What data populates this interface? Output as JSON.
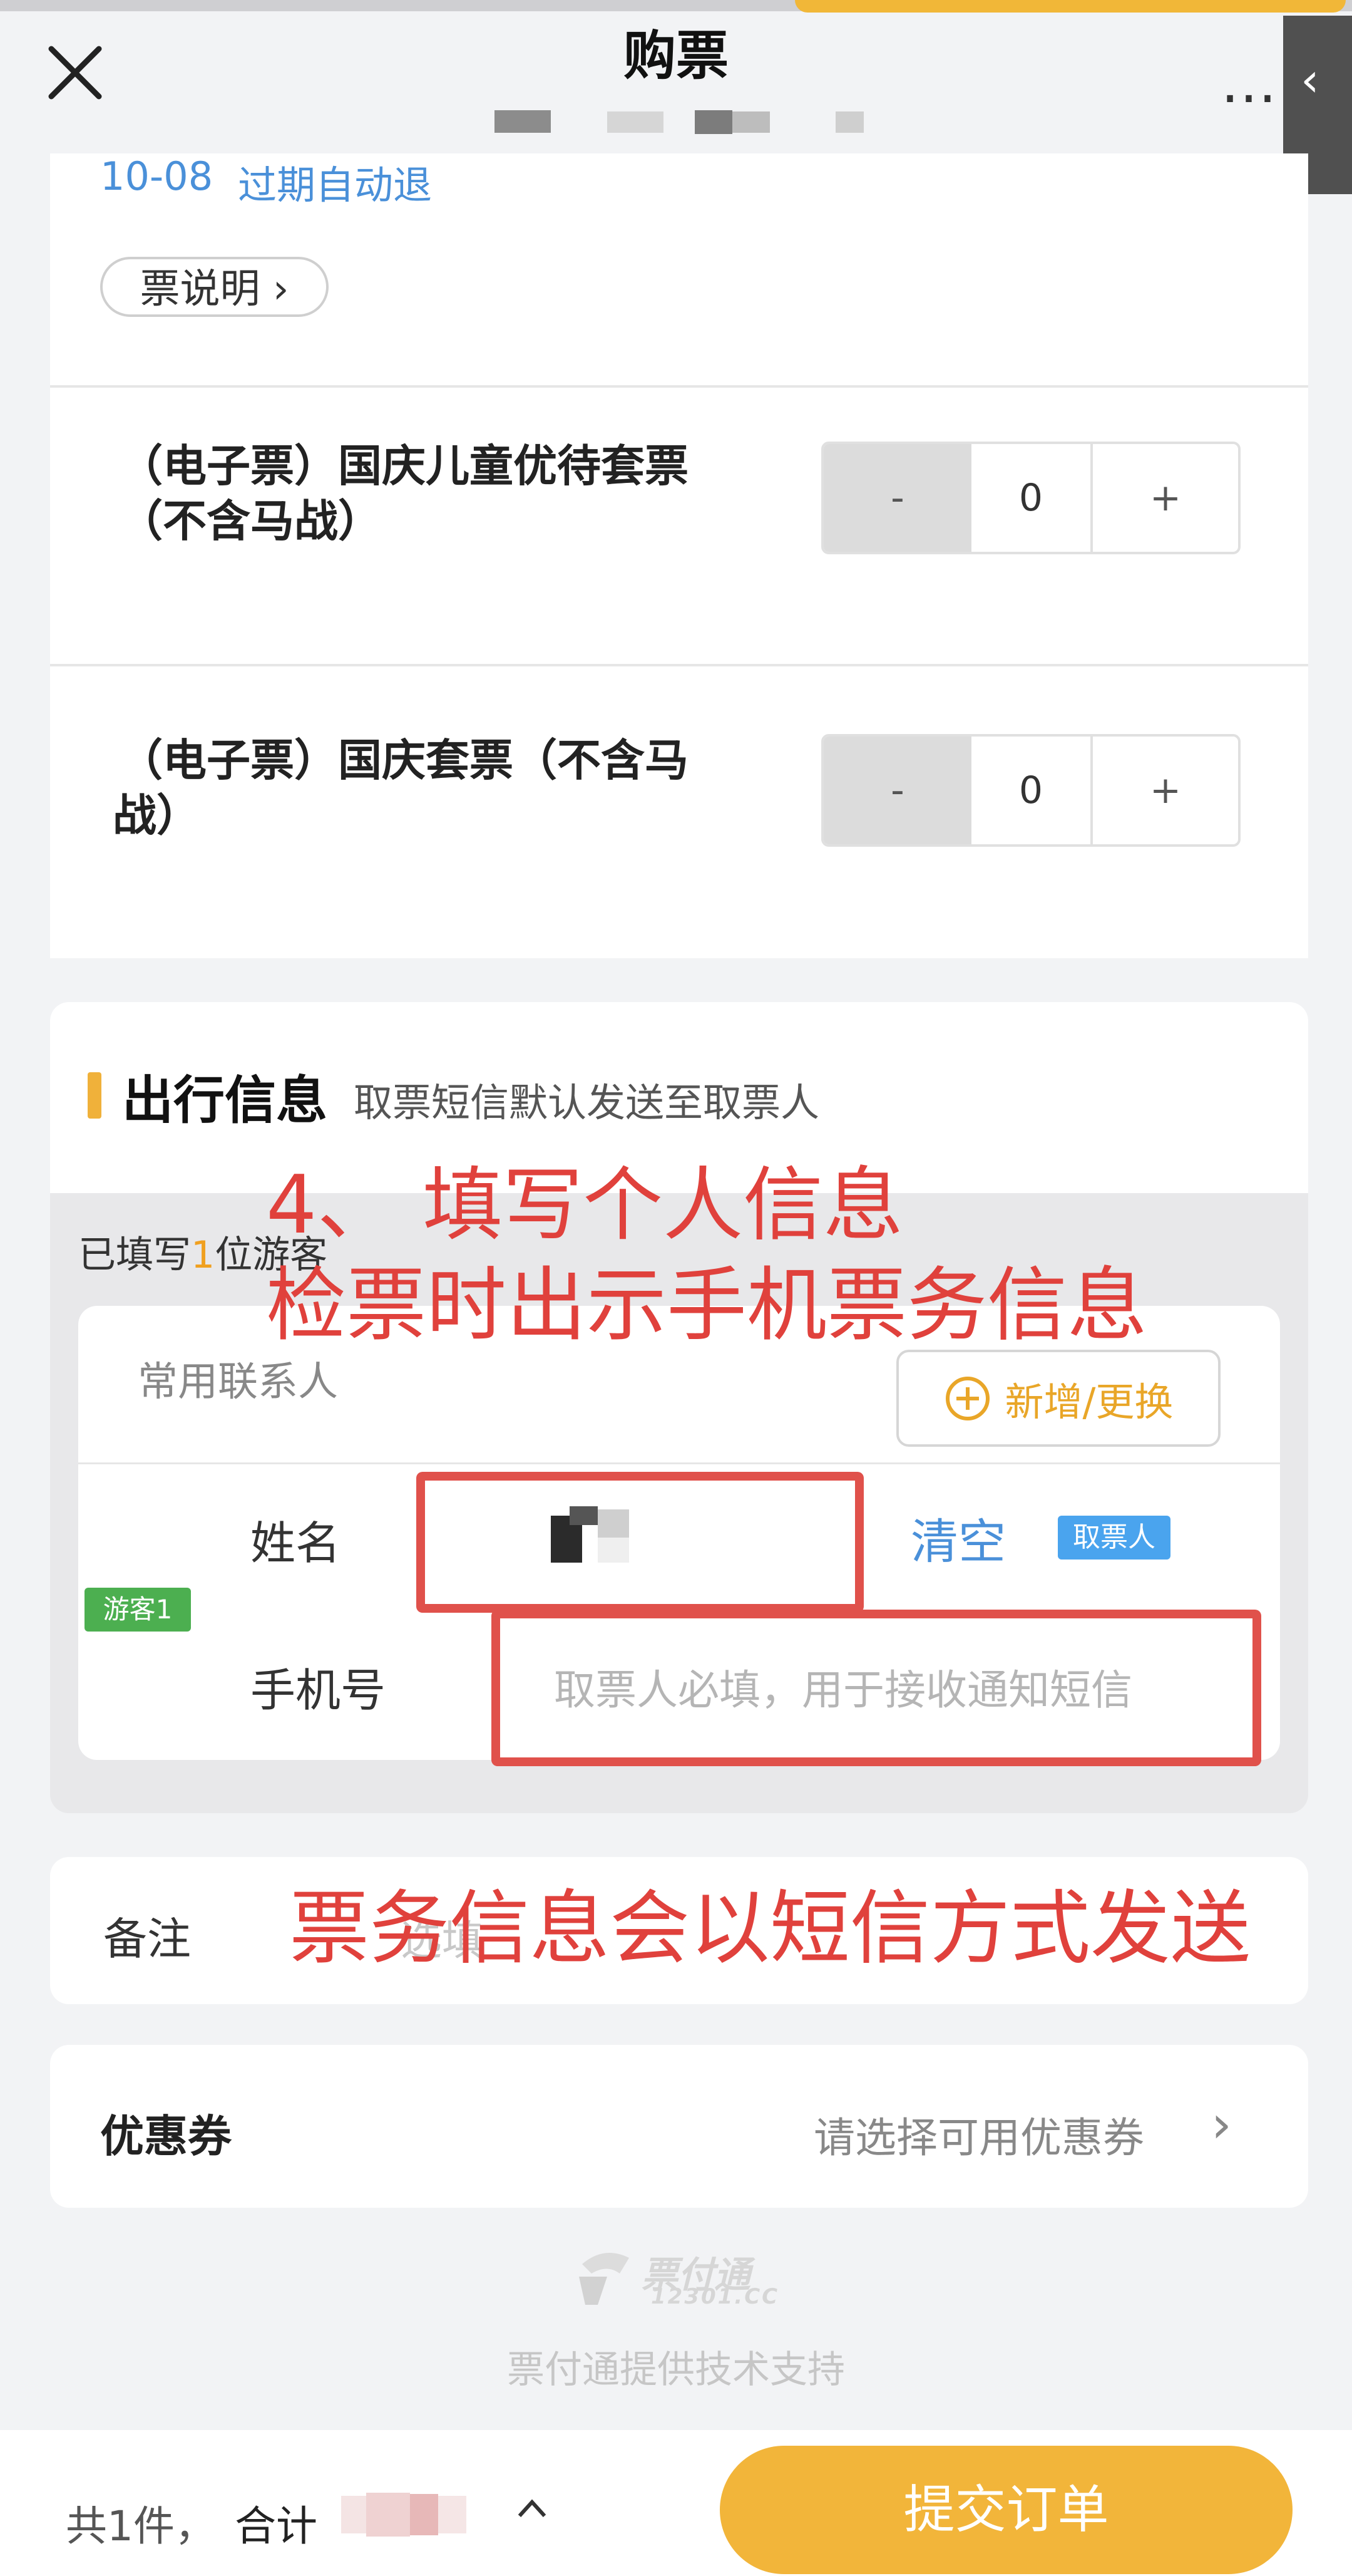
{
  "header": {
    "title": "购票",
    "more_icon": "…",
    "back_icon": "‹"
  },
  "ticket_block": {
    "validity_date": "10-08",
    "refund_policy": "过期自动退",
    "description_label": "票说明"
  },
  "tickets": [
    {
      "name_line1": "（电子票）国庆儿童优待套票",
      "name_line2": "（不含马战）",
      "minus": "-",
      "quantity": "0",
      "plus": "+"
    },
    {
      "name_line1": "（电子票）国庆套票（不含马",
      "name_line2": "战）",
      "minus": "-",
      "quantity": "0",
      "plus": "+"
    }
  ],
  "travel_info": {
    "title": "出行信息",
    "hint": "取票短信默认发送至取票人",
    "filled_prefix": "已填写",
    "filled_count": "1",
    "filled_suffix": "位游客",
    "contacts_label": "常用联系人",
    "add_button": "新增/更换",
    "name_label": "姓名",
    "clear_button": "清空",
    "picker_badge": "取票人",
    "guest_badge": "游客1",
    "phone_label": "手机号",
    "phone_placeholder": "取票人必填，用于接收通知短信"
  },
  "annotations": {
    "step_line1": "4、 填写个人信息",
    "step_line2": "检票时出示手机票务信息",
    "sms_note": "票务信息会以短信方式发送"
  },
  "remark": {
    "label": "备注",
    "placeholder": "选填"
  },
  "coupon": {
    "label": "优惠券",
    "value": "请选择可用优惠券"
  },
  "footer": {
    "logo_main": "票付通",
    "logo_sub": "12301.CC",
    "support_text": "票付通提供技术支持"
  },
  "bottom_bar": {
    "count_text": "共1件，",
    "total_label": "合计",
    "submit_button": "提交订单"
  },
  "colors": {
    "accent": "#f2b53a",
    "link": "#4a90d9",
    "annotation": "#e0413c"
  }
}
